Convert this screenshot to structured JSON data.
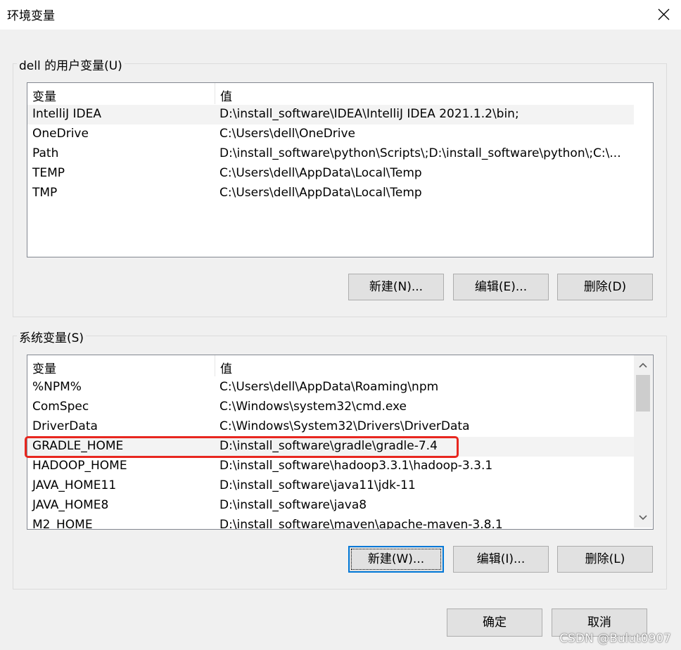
{
  "window": {
    "title": "环境变量",
    "close_glyph": "close-icon"
  },
  "user_group": {
    "label": "dell 的用户变量(U)",
    "columns": {
      "var": "变量",
      "val": "值"
    },
    "rows": [
      {
        "var": "IntelliJ IDEA",
        "val": "D:\\install_software\\IDEA\\IntelliJ IDEA 2021.1.2\\bin;"
      },
      {
        "var": "OneDrive",
        "val": "C:\\Users\\dell\\OneDrive"
      },
      {
        "var": "Path",
        "val": "D:\\install_software\\python\\Scripts\\;D:\\install_software\\python\\;C:\\..."
      },
      {
        "var": "TEMP",
        "val": "C:\\Users\\dell\\AppData\\Local\\Temp"
      },
      {
        "var": "TMP",
        "val": "C:\\Users\\dell\\AppData\\Local\\Temp"
      }
    ],
    "buttons": {
      "new": "新建(N)...",
      "edit": "编辑(E)...",
      "delete": "删除(D)"
    }
  },
  "system_group": {
    "label": "系统变量(S)",
    "columns": {
      "var": "变量",
      "val": "值"
    },
    "rows": [
      {
        "var": "%NPM%",
        "val": "C:\\Users\\dell\\AppData\\Roaming\\npm"
      },
      {
        "var": "ComSpec",
        "val": "C:\\Windows\\system32\\cmd.exe"
      },
      {
        "var": "DriverData",
        "val": "C:\\Windows\\System32\\Drivers\\DriverData"
      },
      {
        "var": "GRADLE_HOME",
        "val": "D:\\install_software\\gradle\\gradle-7.4"
      },
      {
        "var": "HADOOP_HOME",
        "val": "D:\\install_software\\hadoop3.3.1\\hadoop-3.3.1"
      },
      {
        "var": "JAVA_HOME11",
        "val": "D:\\install_software\\java11\\jdk-11"
      },
      {
        "var": "JAVA_HOME8",
        "val": "D:\\install_software\\java8"
      },
      {
        "var": "M2_HOME",
        "val": "D:\\install_software\\maven\\apache-maven-3.8.1"
      }
    ],
    "highlighted_row": "GRADLE_HOME",
    "buttons": {
      "new": "新建(W)...",
      "edit": "编辑(I)...",
      "delete": "删除(L)"
    }
  },
  "footer": {
    "ok": "确定",
    "cancel": "取消"
  },
  "watermark": "CSDN @Bulut0907",
  "colors": {
    "highlight": "#e8271f",
    "focus": "#0078d7"
  }
}
